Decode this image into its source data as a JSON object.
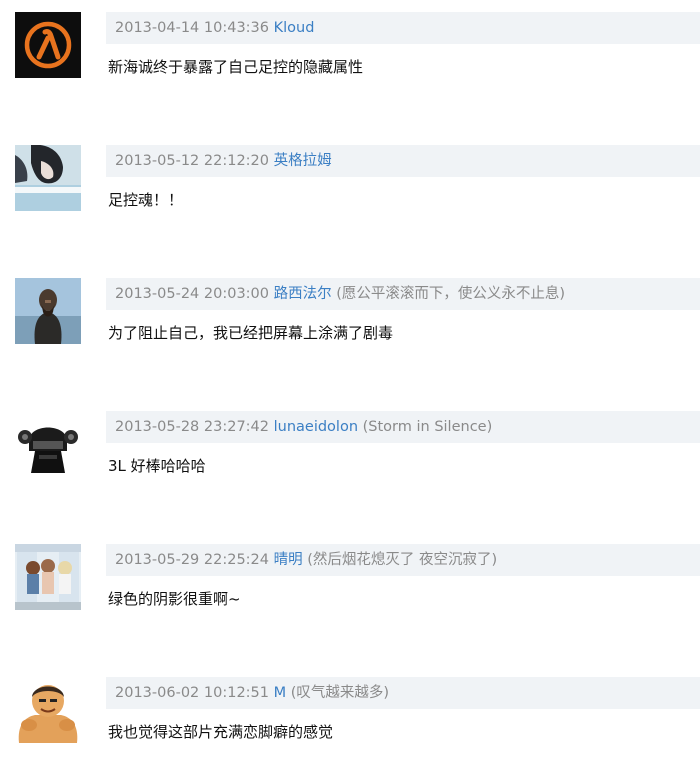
{
  "comments": [
    {
      "timestamp": "2013-04-14 10:43:36",
      "user": "Kloud",
      "signature": "",
      "text": "新海诚终于暴露了自己足控的隐藏属性",
      "avatar": "half-life-lambda-icon"
    },
    {
      "timestamp": "2013-05-12 22:12:20",
      "user": "英格拉姆",
      "signature": "",
      "text": "足控魂！！",
      "avatar": "anime-character-avatar"
    },
    {
      "timestamp": "2013-05-24 20:03:00",
      "user": "路西法尔",
      "signature": "(愿公平滚滚而下，使公义永不止息)",
      "text": "为了阻止自己，我已经把屏幕上涂满了剧毒",
      "avatar": "bearded-man-avatar"
    },
    {
      "timestamp": "2013-05-28 23:27:42",
      "user": "lunaeidolon",
      "signature": "(Storm in Silence)",
      "text": "3L 好棒哈哈哈",
      "avatar": "helmet-figure-avatar"
    },
    {
      "timestamp": "2013-05-29 22:25:24",
      "user": "晴明",
      "signature": "(然后烟花熄灭了 夜空沉寂了)",
      "text": "绿色的阴影很重啊~",
      "avatar": "anime-girls-avatar"
    },
    {
      "timestamp": "2013-06-02 10:12:51",
      "user": "M",
      "signature": "(叹气越来越多)",
      "text": "我也觉得这部片充满恋脚癖的感觉",
      "avatar": "muscle-man-avatar"
    }
  ]
}
